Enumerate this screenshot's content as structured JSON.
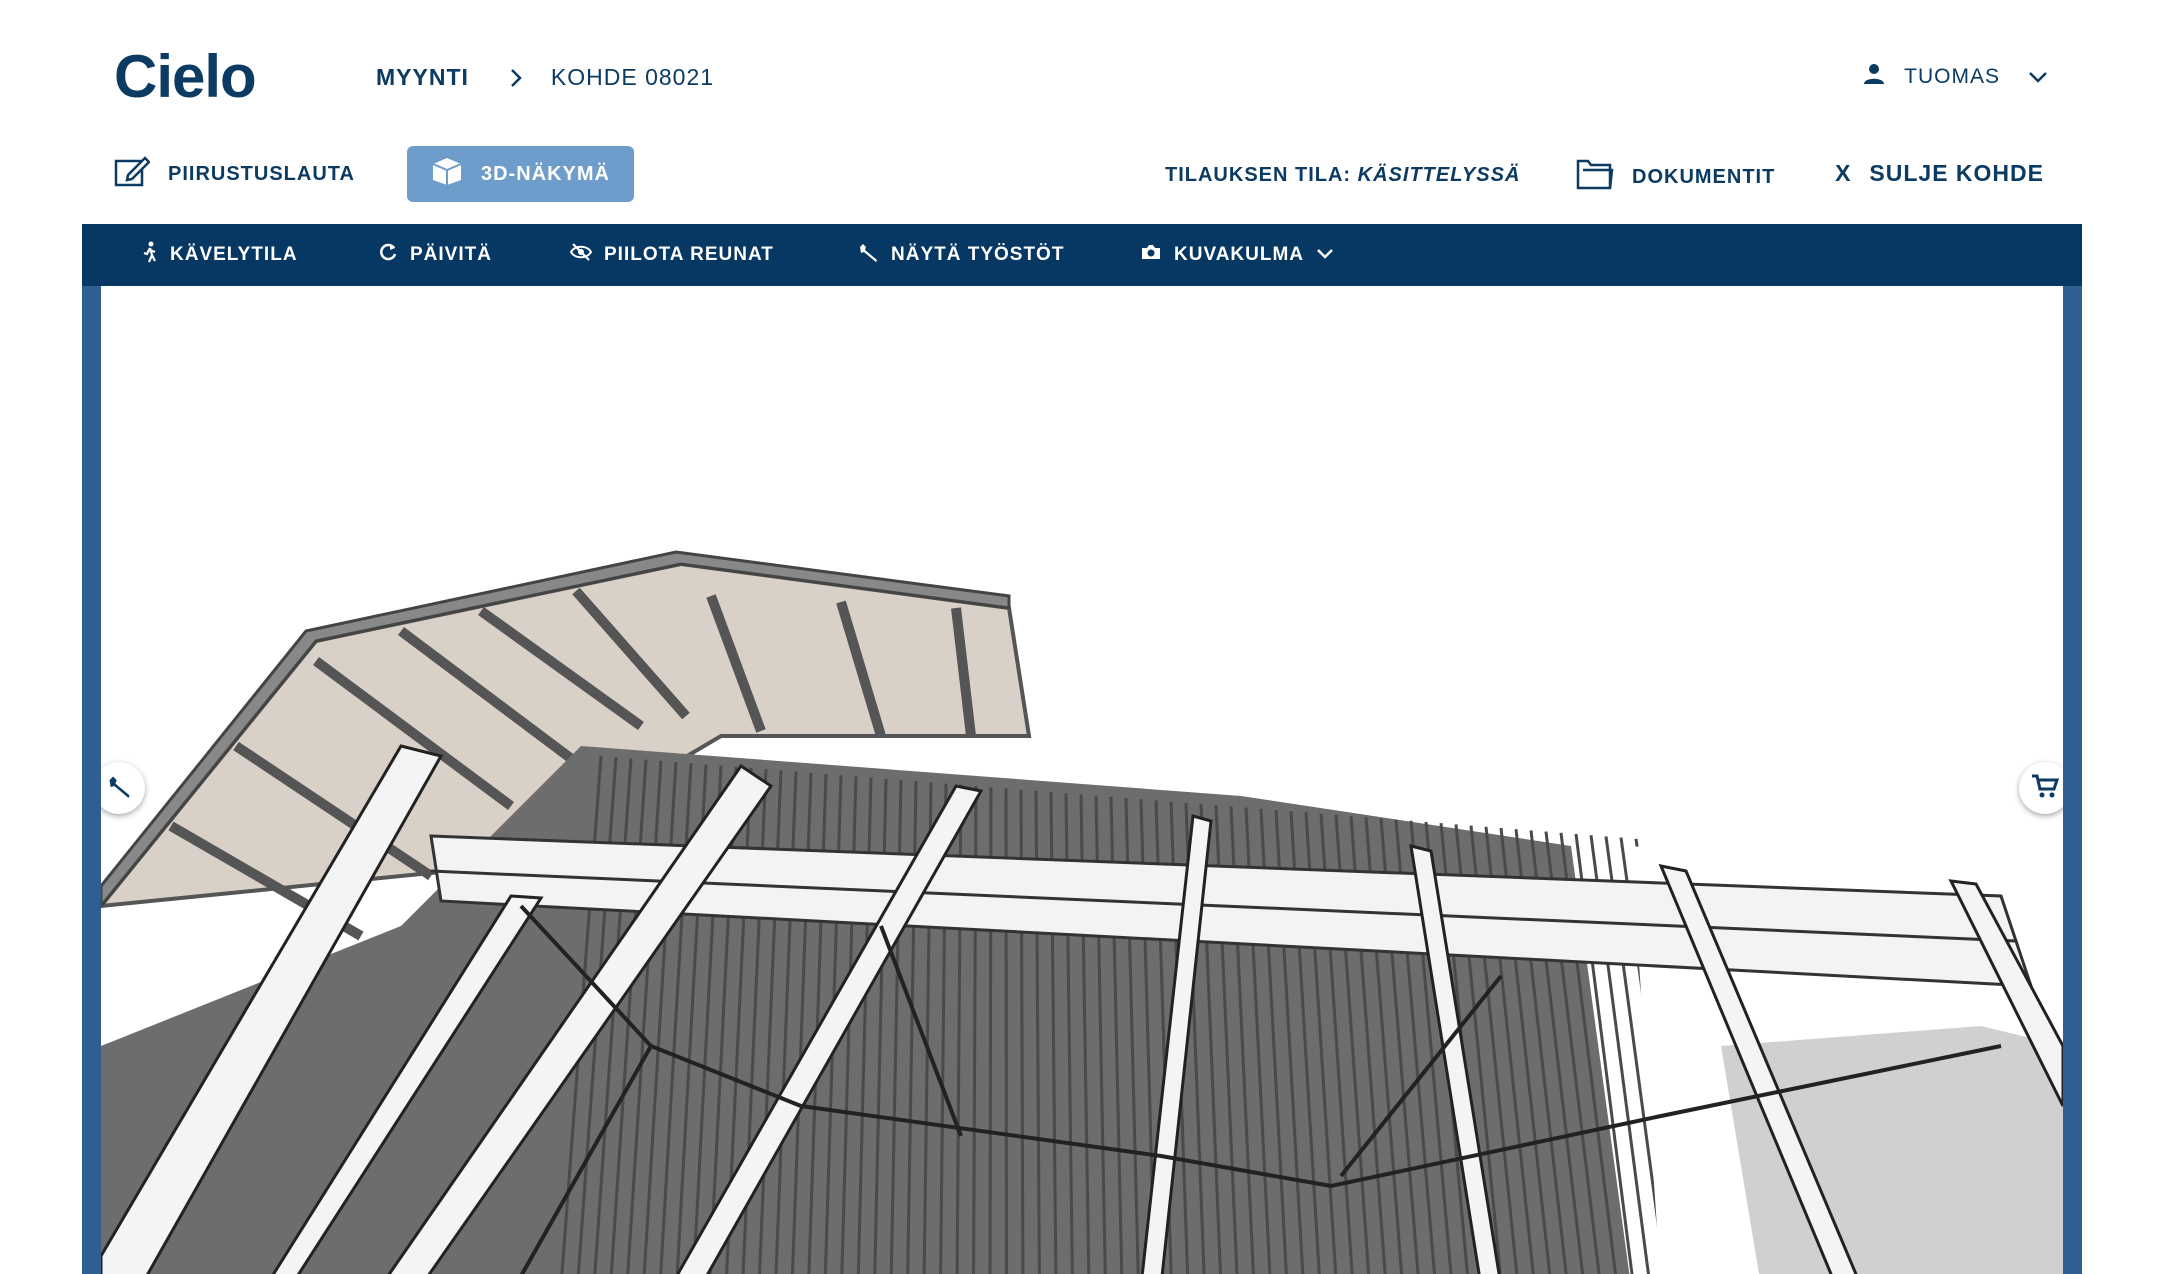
{
  "app": {
    "logo": "Cielo"
  },
  "breadcrumb": {
    "root": "MYYNTI",
    "current": "KOHDE 08021"
  },
  "user": {
    "name": "TUOMAS"
  },
  "tabs": [
    {
      "label": "PIIRUSTUSLAUTA",
      "icon": "edit-icon",
      "active": false
    },
    {
      "label": "3D-NÄKYMÄ",
      "icon": "cube-icon",
      "active": true
    }
  ],
  "order_status": {
    "label": "TILAUKSEN TILA:",
    "value": "KÄSITTELYSSÄ"
  },
  "documents": {
    "label": "DOKUMENTIT"
  },
  "close": {
    "mark": "X",
    "label": "SULJE KOHDE"
  },
  "toolbar": {
    "walk": "KÄVELYTILA",
    "refresh": "PÄIVITÄ",
    "hide_edges": "PIILOTA REUNAT",
    "show_work": "NÄYTÄ TYÖSTÖT",
    "camera": "KUVAKULMA"
  },
  "colors": {
    "primary": "#073763",
    "accent": "#6e9ccb",
    "frame": "#2f5f90"
  }
}
